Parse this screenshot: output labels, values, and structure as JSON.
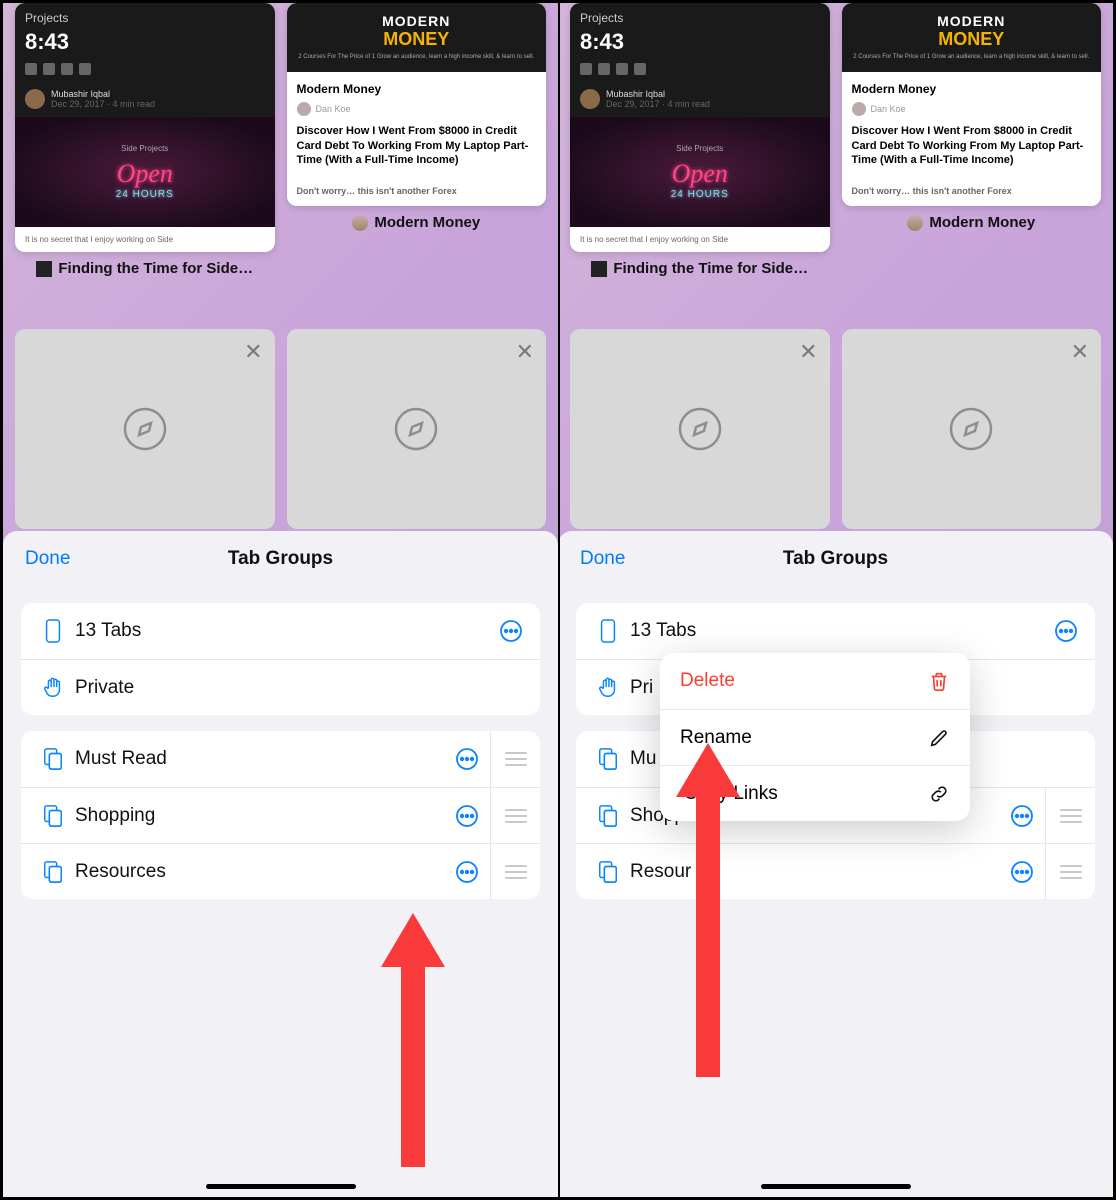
{
  "status_time": "8:43",
  "tab1": {
    "author": "Mubashir Iqbal",
    "meta": "Dec 29, 2017 · 4 min read",
    "side_projects": "Side Projects",
    "open": "Open",
    "hours": "24 HOURS",
    "bottom": "It is no secret that I enjoy working on Side",
    "label": "Finding the Time for Side…"
  },
  "tab2": {
    "modern": "MODERN",
    "money": "MONEY",
    "sub": "2 Courses For The Price of 1\nGrow an audience, learn a high income skill, & learn to sell.",
    "body_title": "Modern Money",
    "body_author": "Dan Koe",
    "body_desc": "Discover How I Went From $8000 in Credit Card Debt To Working From My Laptop Part-Time (With a Full-Time Income)",
    "body_worry": "Don't worry… this isn't another Forex",
    "label": "Modern Money"
  },
  "sheet": {
    "done": "Done",
    "title": "Tab Groups",
    "tabs_count": "13 Tabs",
    "private": "Private",
    "groups": [
      "Must Read",
      "Shopping",
      "Resources"
    ]
  },
  "ctx": {
    "delete": "Delete",
    "rename": "Rename",
    "copy": "Copy Links",
    "partial_private": "Pri",
    "partial_must": "Mu",
    "partial_shopping": "Shopp",
    "partial_resources": "Resour"
  }
}
